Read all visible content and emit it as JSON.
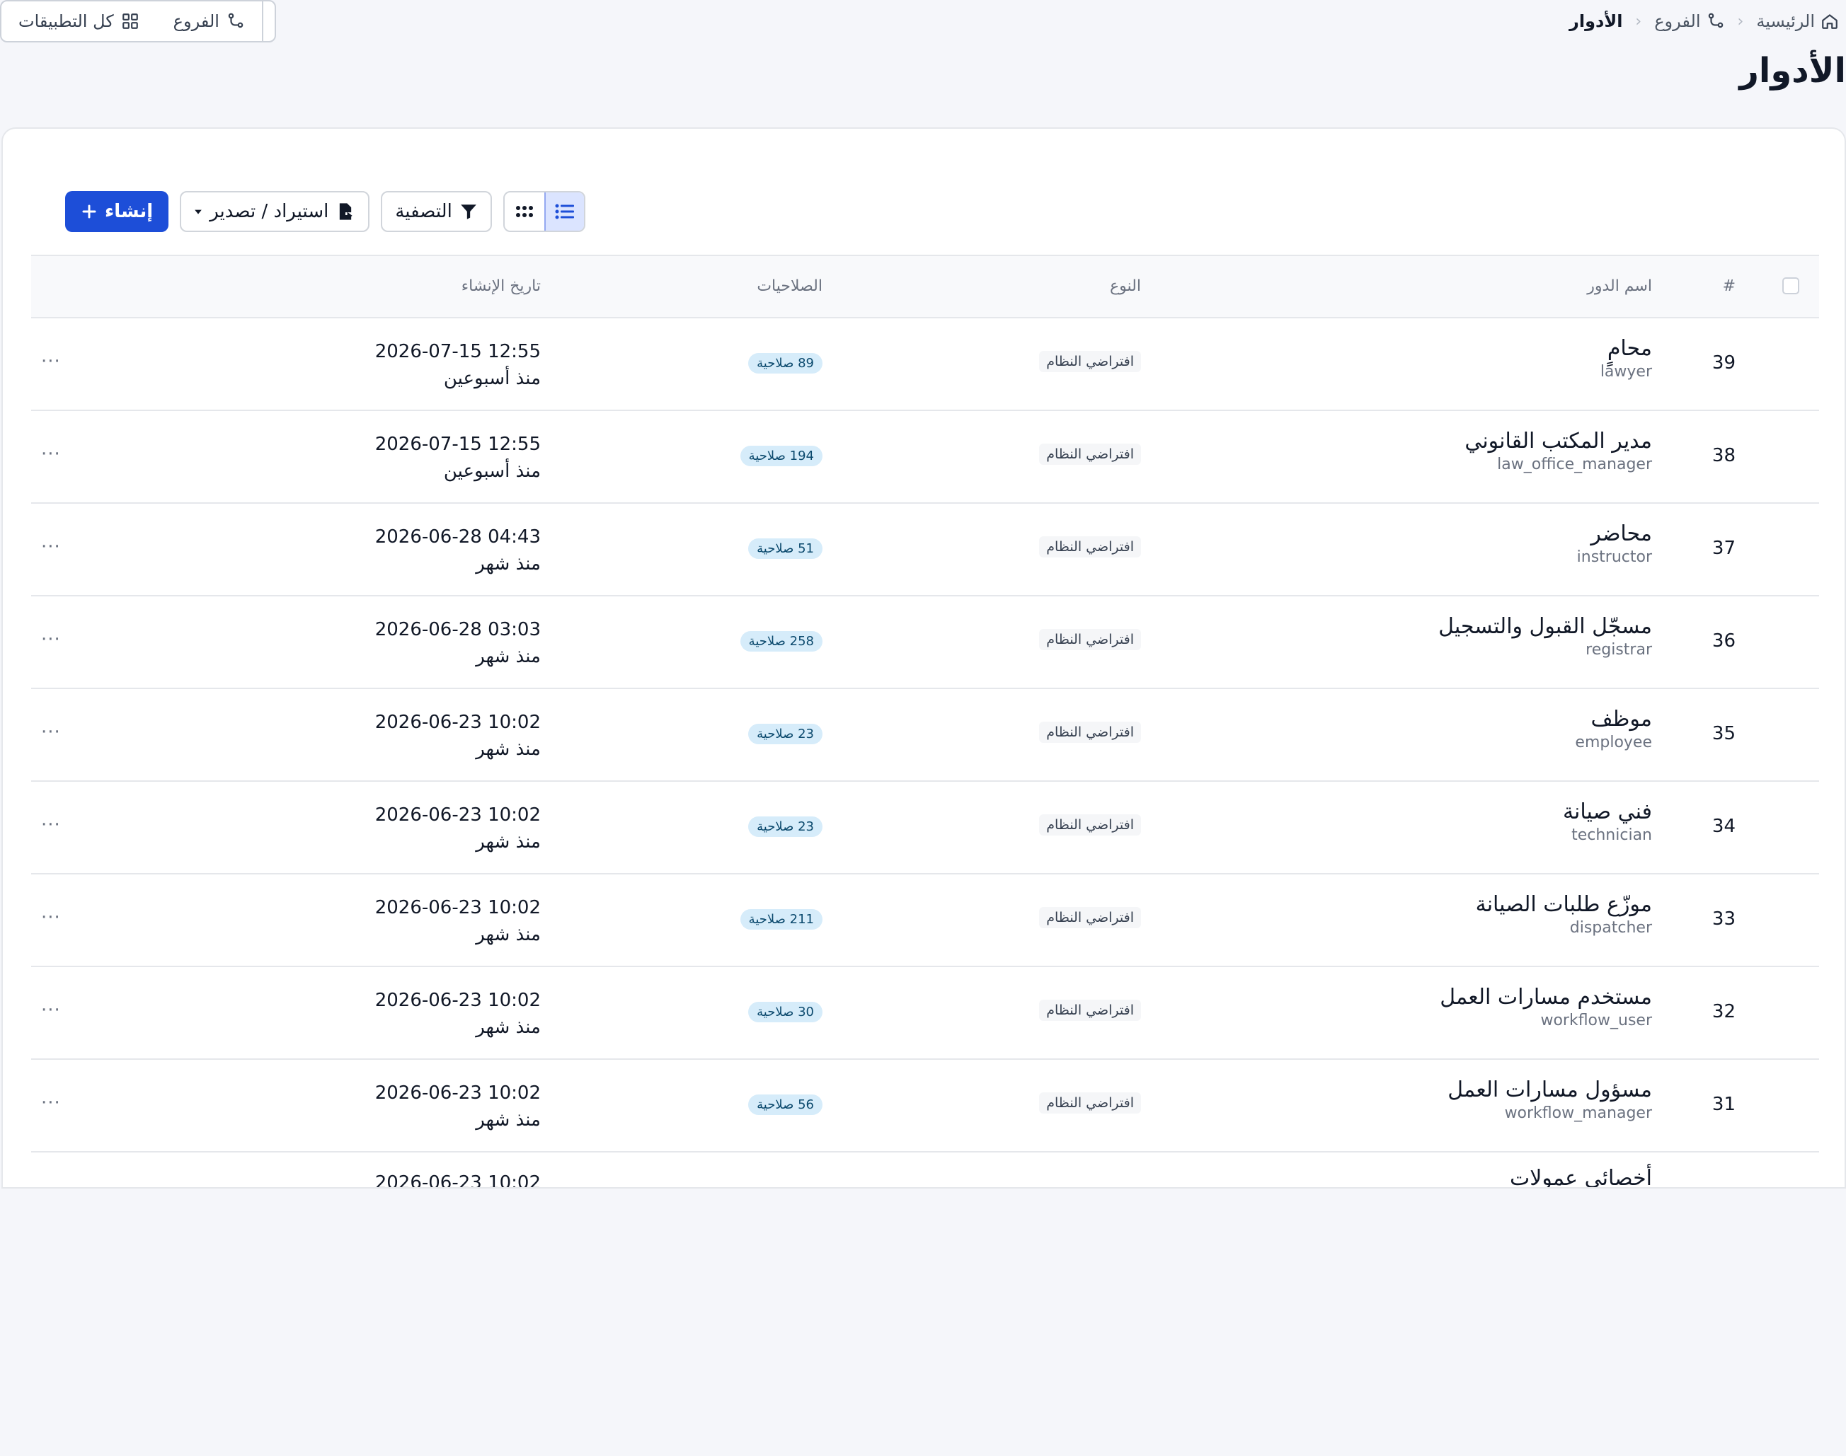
{
  "breadcrumb": {
    "home": "الرئيسية",
    "branches": "الفروع",
    "current": "الأدوار"
  },
  "top_buttons": {
    "all_apps": "كل التطبيقات",
    "branches": "الفروع"
  },
  "page": {
    "title": "الأدوار"
  },
  "toolbar": {
    "create": "إنشاء",
    "import_export": "استيراد / تصدير",
    "filter": "التصفية"
  },
  "table": {
    "headers": {
      "num": "#",
      "name": "اسم الدور",
      "type": "النوع",
      "permissions": "الصلاحيات",
      "created": "تاريخ الإنشاء"
    },
    "rows": [
      {
        "num": "39",
        "title": "محامٍ",
        "key": "lawyer",
        "type": "افتراضي النظام",
        "perms": "89 صلاحية",
        "date": "2026-07-15 12:55",
        "rel": "منذ أسبوعين"
      },
      {
        "num": "38",
        "title": "مدير المكتب القانوني",
        "key": "law_office_manager",
        "type": "افتراضي النظام",
        "perms": "194 صلاحية",
        "date": "2026-07-15 12:55",
        "rel": "منذ أسبوعين"
      },
      {
        "num": "37",
        "title": "محاضر",
        "key": "instructor",
        "type": "افتراضي النظام",
        "perms": "51 صلاحية",
        "date": "2026-06-28 04:43",
        "rel": "منذ شهر"
      },
      {
        "num": "36",
        "title": "مسجّل القبول والتسجيل",
        "key": "registrar",
        "type": "افتراضي النظام",
        "perms": "258 صلاحية",
        "date": "2026-06-28 03:03",
        "rel": "منذ شهر"
      },
      {
        "num": "35",
        "title": "موظف",
        "key": "employee",
        "type": "افتراضي النظام",
        "perms": "23 صلاحية",
        "date": "2026-06-23 10:02",
        "rel": "منذ شهر"
      },
      {
        "num": "34",
        "title": "فني صيانة",
        "key": "technician",
        "type": "افتراضي النظام",
        "perms": "23 صلاحية",
        "date": "2026-06-23 10:02",
        "rel": "منذ شهر"
      },
      {
        "num": "33",
        "title": "موزّع طلبات الصيانة",
        "key": "dispatcher",
        "type": "افتراضي النظام",
        "perms": "211 صلاحية",
        "date": "2026-06-23 10:02",
        "rel": "منذ شهر"
      },
      {
        "num": "32",
        "title": "مستخدم مسارات العمل",
        "key": "workflow_user",
        "type": "افتراضي النظام",
        "perms": "30 صلاحية",
        "date": "2026-06-23 10:02",
        "rel": "منذ شهر"
      },
      {
        "num": "31",
        "title": "مسؤول مسارات العمل",
        "key": "workflow_manager",
        "type": "افتراضي النظام",
        "perms": "56 صلاحية",
        "date": "2026-06-23 10:02",
        "rel": "منذ شهر"
      }
    ],
    "partial_row": {
      "title": "أخصائي عمولات",
      "date": "2026-06-23 10:02"
    },
    "action_glyph": "···"
  },
  "colors": {
    "primary": "#1d4ed8",
    "badge_bg": "#d6ecfa",
    "page_bg": "#f5f6fa"
  },
  "icons": [
    "home-icon",
    "branch-icon",
    "grid-icon",
    "filter-icon",
    "export-file-icon",
    "list-icon",
    "dots-grid-icon",
    "plus-icon",
    "caret-down-icon"
  ]
}
